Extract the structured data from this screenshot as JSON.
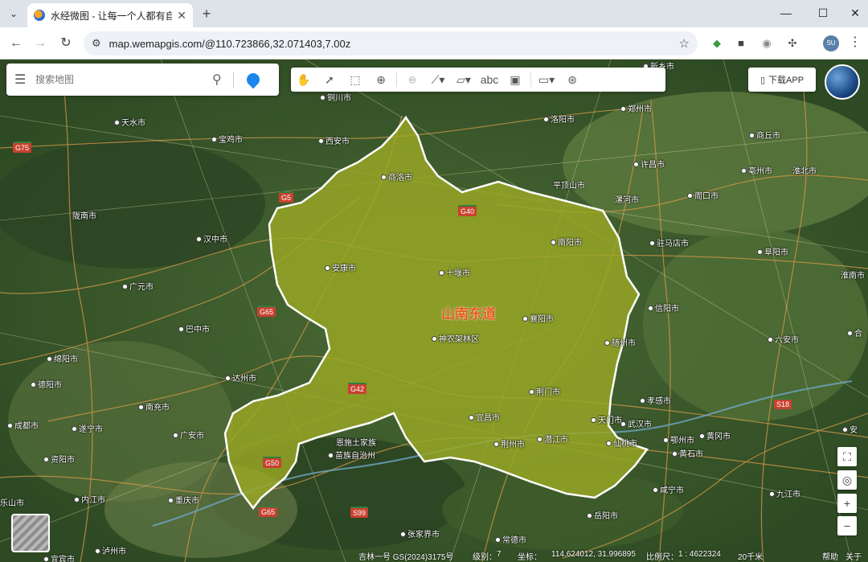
{
  "browser": {
    "tab_title": "水经微图 - 让每一个人都有自己",
    "url": "map.wemapgis.com/@110.723866,32.071403,7.00z",
    "avatar_initials": "SU"
  },
  "search": {
    "placeholder": "搜索地图"
  },
  "download_app": "下载APP",
  "region": {
    "name": "山南东道",
    "fill_color": "#9aa824",
    "border_color": "#ffffff",
    "label_color": "#e85a1a"
  },
  "cities": [
    {
      "name": "新乡市"
    },
    {
      "name": "铜川市"
    },
    {
      "name": "郑州市"
    },
    {
      "name": "天水市"
    },
    {
      "name": "宝鸡市"
    },
    {
      "name": "西安市"
    },
    {
      "name": "洛阳市"
    },
    {
      "name": "商丘市"
    },
    {
      "name": "商洛市"
    },
    {
      "name": "许昌市"
    },
    {
      "name": "亳州市"
    },
    {
      "name": "淮北市"
    },
    {
      "name": "平顶山市"
    },
    {
      "name": "漯河市"
    },
    {
      "name": "周口市"
    },
    {
      "name": "陇南市"
    },
    {
      "name": "汉中市"
    },
    {
      "name": "南阳市"
    },
    {
      "name": "驻马店市"
    },
    {
      "name": "阜阳市"
    },
    {
      "name": "安康市"
    },
    {
      "name": "十堰市"
    },
    {
      "name": "淮南市"
    },
    {
      "name": "广元市"
    },
    {
      "name": "信阳市"
    },
    {
      "name": "襄阳市"
    },
    {
      "name": "巴中市"
    },
    {
      "name": "神农架林区"
    },
    {
      "name": "六安市"
    },
    {
      "name": "随州市"
    },
    {
      "name": "绵阳市"
    },
    {
      "name": "达州市"
    },
    {
      "name": "德阳市"
    },
    {
      "name": "荆门市"
    },
    {
      "name": "孝感市"
    },
    {
      "name": "南充市"
    },
    {
      "name": "成都市"
    },
    {
      "name": "遂宁市"
    },
    {
      "name": "广安市"
    },
    {
      "name": "宜昌市"
    },
    {
      "name": "天门市"
    },
    {
      "name": "武汉市"
    },
    {
      "name": "恩施土家族"
    },
    {
      "name": "苗族自治州"
    },
    {
      "name": "荆州市"
    },
    {
      "name": "潜江市"
    },
    {
      "name": "仙桃市"
    },
    {
      "name": "鄂州市"
    },
    {
      "name": "黄冈市"
    },
    {
      "name": "资阳市"
    },
    {
      "name": "黄石市"
    },
    {
      "name": "内江市"
    },
    {
      "name": "重庆市"
    },
    {
      "name": "咸宁市"
    },
    {
      "name": "九江市"
    },
    {
      "name": "岳阳市"
    },
    {
      "name": "张家界市"
    },
    {
      "name": "常德市"
    },
    {
      "name": "宜宾市"
    },
    {
      "name": "泸州市"
    },
    {
      "name": "乐山市"
    },
    {
      "name": "合"
    },
    {
      "name": "安"
    }
  ],
  "highways": [
    "G75",
    "G5",
    "G40",
    "G65",
    "G42",
    "G50",
    "G65",
    "S99",
    "S18"
  ],
  "status": {
    "source": "吉林一号 GS(2024)3175号",
    "level_label": "级别：",
    "level": "7",
    "coord_label": "坐标：",
    "coords": "114.624012, 31.996895",
    "scale_label": "比例尺：",
    "scale": "1 : 4622324",
    "scale_bar": "20千米",
    "help": "帮助",
    "about": "关于"
  }
}
